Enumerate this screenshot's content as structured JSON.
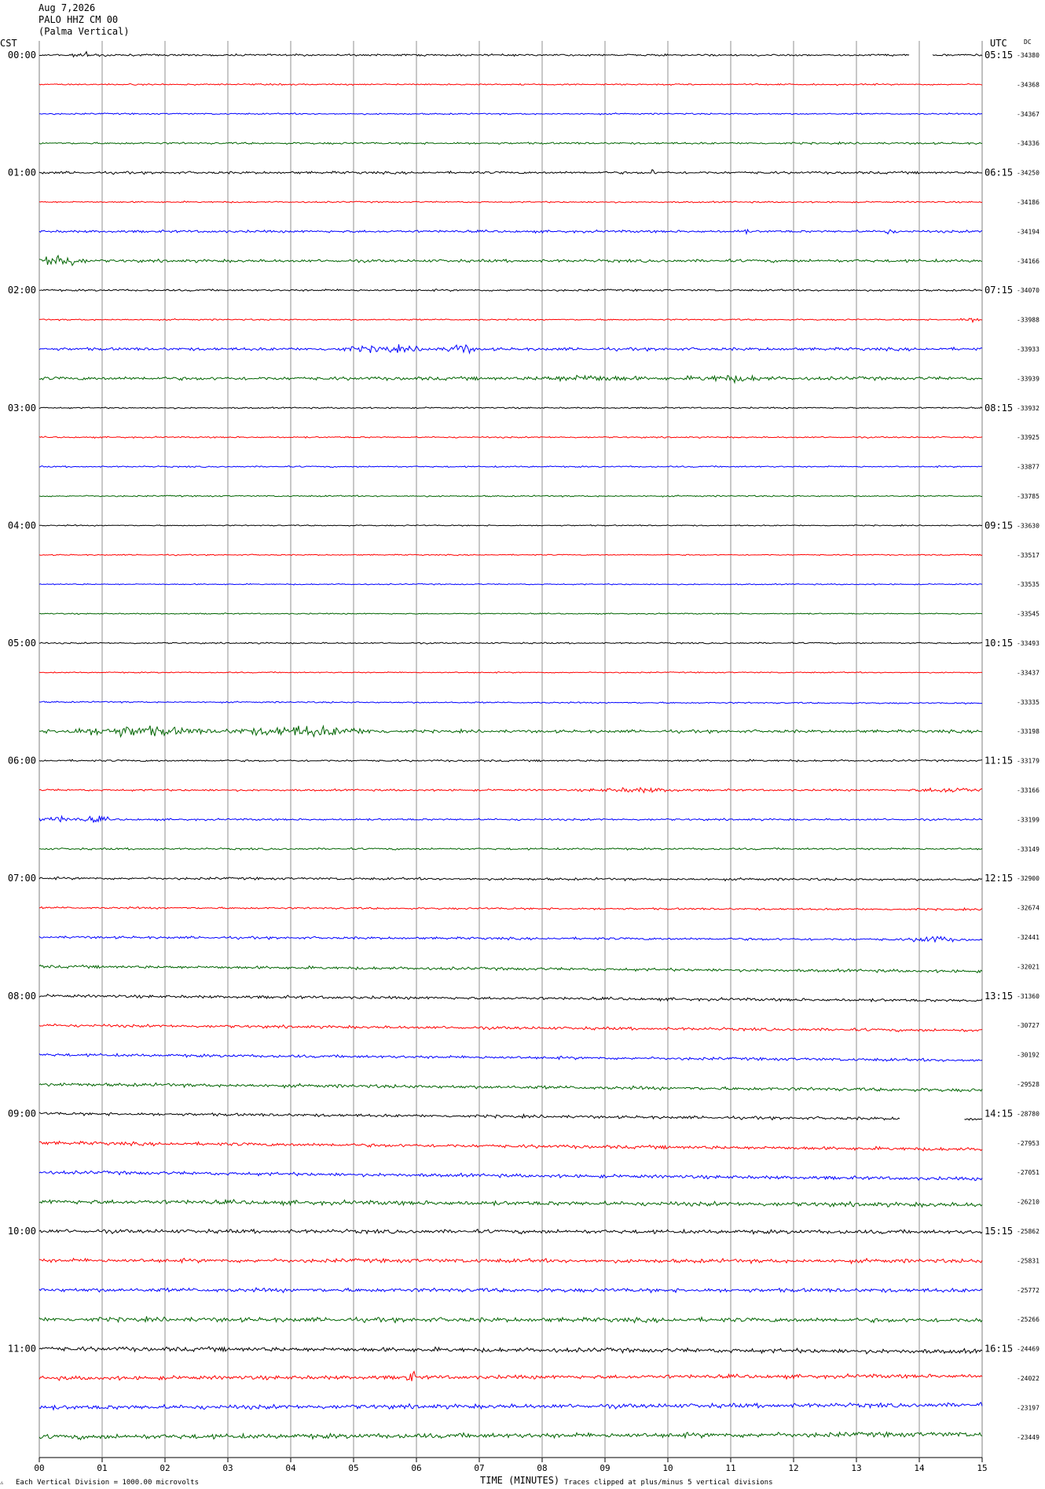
{
  "header": {
    "date": "Aug 7,2026",
    "station": "PALO HHZ CM 00",
    "location": "(Palma Vertical)"
  },
  "labels": {
    "left_timezone": "CST",
    "right_timezone": "UTC",
    "dc_header": "DC"
  },
  "footer": {
    "scale_note": "Each Vertical Division = 1000.00 microvolts",
    "xlabel": "TIME (MINUTES)",
    "clip_note": "Traces clipped at plus/minus 5 vertical divisions"
  },
  "chart_data": {
    "type": "line",
    "title": "",
    "xlabel": "TIME (MINUTES)",
    "ylabel": "",
    "xlim": [
      0,
      15
    ],
    "x_ticks": [
      "00",
      "01",
      "02",
      "03",
      "04",
      "05",
      "06",
      "07",
      "08",
      "09",
      "10",
      "11",
      "12",
      "13",
      "14",
      "15"
    ],
    "grid": true,
    "trace_minutes": 15,
    "trace_colors": [
      "#000000",
      "#ff0000",
      "#0000ff",
      "#006400"
    ],
    "left_hour_labels": [
      "00:00",
      "01:00",
      "02:00",
      "03:00",
      "04:00",
      "05:00",
      "06:00",
      "07:00",
      "08:00",
      "09:00",
      "10:00",
      "11:00"
    ],
    "right_hour_labels": [
      "05:15",
      "06:15",
      "07:15",
      "08:15",
      "09:15",
      "10:15",
      "11:15",
      "12:15",
      "13:15",
      "14:15",
      "15:15",
      "16:15"
    ],
    "dc_offsets": [
      -34380,
      -34368,
      -34367,
      -34336,
      -34250,
      -34186,
      -34194,
      -34166,
      -34070,
      -33988,
      -33933,
      -33939,
      -33932,
      -33925,
      -33877,
      -33785,
      -33630,
      -33517,
      -33535,
      -33545,
      -33493,
      -33437,
      -33335,
      -33198,
      -33179,
      -33166,
      -33199,
      -33149,
      -32900,
      -32674,
      -32441,
      -32021,
      -31360,
      -30727,
      -30192,
      -29528,
      -28780,
      -27953,
      -27051,
      -26210,
      -25862,
      -25831,
      -25772,
      -25266,
      -24469,
      -24022,
      -23197,
      -23449
    ],
    "trace_drift": [
      0,
      0,
      0,
      0,
      0,
      0,
      0,
      0,
      0,
      0,
      0,
      0,
      0,
      0,
      0,
      0,
      0,
      0,
      0,
      0,
      0,
      0,
      0.3,
      0,
      0,
      0,
      0,
      0,
      0.3,
      0.4,
      0.6,
      1.1,
      1.1,
      1.2,
      1.3,
      1.4,
      1.3,
      1.5,
      1.5,
      0.7,
      0.2,
      0.1,
      0.1,
      0.2,
      0.6,
      -0.5,
      -0.6,
      -0.6
    ],
    "noise_level": [
      0.2,
      0.15,
      0.15,
      0.2,
      0.25,
      0.15,
      0.25,
      0.3,
      0.2,
      0.15,
      0.3,
      0.35,
      0.15,
      0.15,
      0.15,
      0.15,
      0.12,
      0.12,
      0.12,
      0.12,
      0.15,
      0.12,
      0.15,
      0.3,
      0.2,
      0.2,
      0.2,
      0.2,
      0.25,
      0.2,
      0.25,
      0.3,
      0.3,
      0.3,
      0.3,
      0.35,
      0.3,
      0.35,
      0.35,
      0.45,
      0.4,
      0.4,
      0.4,
      0.45,
      0.45,
      0.4,
      0.45,
      0.5
    ],
    "events": [
      {
        "trace": 0,
        "minute": 0.8,
        "amp": 0.4,
        "dur": 0.4
      },
      {
        "trace": 4,
        "minute": 9.75,
        "amp": 0.8,
        "dur": 0.05
      },
      {
        "trace": 6,
        "minute": 11.2,
        "amp": 0.5,
        "dur": 0.1
      },
      {
        "trace": 6,
        "minute": 13.5,
        "amp": 0.5,
        "dur": 0.15
      },
      {
        "trace": 7,
        "minute": 0.3,
        "amp": 1.5,
        "dur": 0.5
      },
      {
        "trace": 9,
        "minute": 14.8,
        "amp": 0.5,
        "dur": 0.2
      },
      {
        "trace": 10,
        "minute": 5.5,
        "amp": 0.5,
        "dur": 1.0
      },
      {
        "trace": 10,
        "minute": 6.7,
        "amp": 1.2,
        "dur": 0.25
      },
      {
        "trace": 11,
        "minute": 8.7,
        "amp": 0.5,
        "dur": 1.0
      },
      {
        "trace": 11,
        "minute": 11.0,
        "amp": 0.5,
        "dur": 0.8
      },
      {
        "trace": 23,
        "minute": 1.5,
        "amp": 1.0,
        "dur": 1.5
      },
      {
        "trace": 23,
        "minute": 4.2,
        "amp": 1.0,
        "dur": 1.5
      },
      {
        "trace": 25,
        "minute": 9.5,
        "amp": 0.4,
        "dur": 1.0
      },
      {
        "trace": 25,
        "minute": 14.5,
        "amp": 0.5,
        "dur": 0.7
      },
      {
        "trace": 26,
        "minute": 0.3,
        "amp": 0.6,
        "dur": 0.4
      },
      {
        "trace": 26,
        "minute": 0.9,
        "amp": 0.6,
        "dur": 0.3
      },
      {
        "trace": 30,
        "minute": 14.2,
        "amp": 0.7,
        "dur": 0.4
      },
      {
        "trace": 45,
        "minute": 5.9,
        "amp": 1.0,
        "dur": 0.15
      }
    ],
    "gaps": [
      {
        "trace": 0,
        "start_minute": 13.85,
        "end_minute": 14.2
      },
      {
        "trace": 36,
        "start_minute": 13.7,
        "end_minute": 14.7
      }
    ]
  }
}
